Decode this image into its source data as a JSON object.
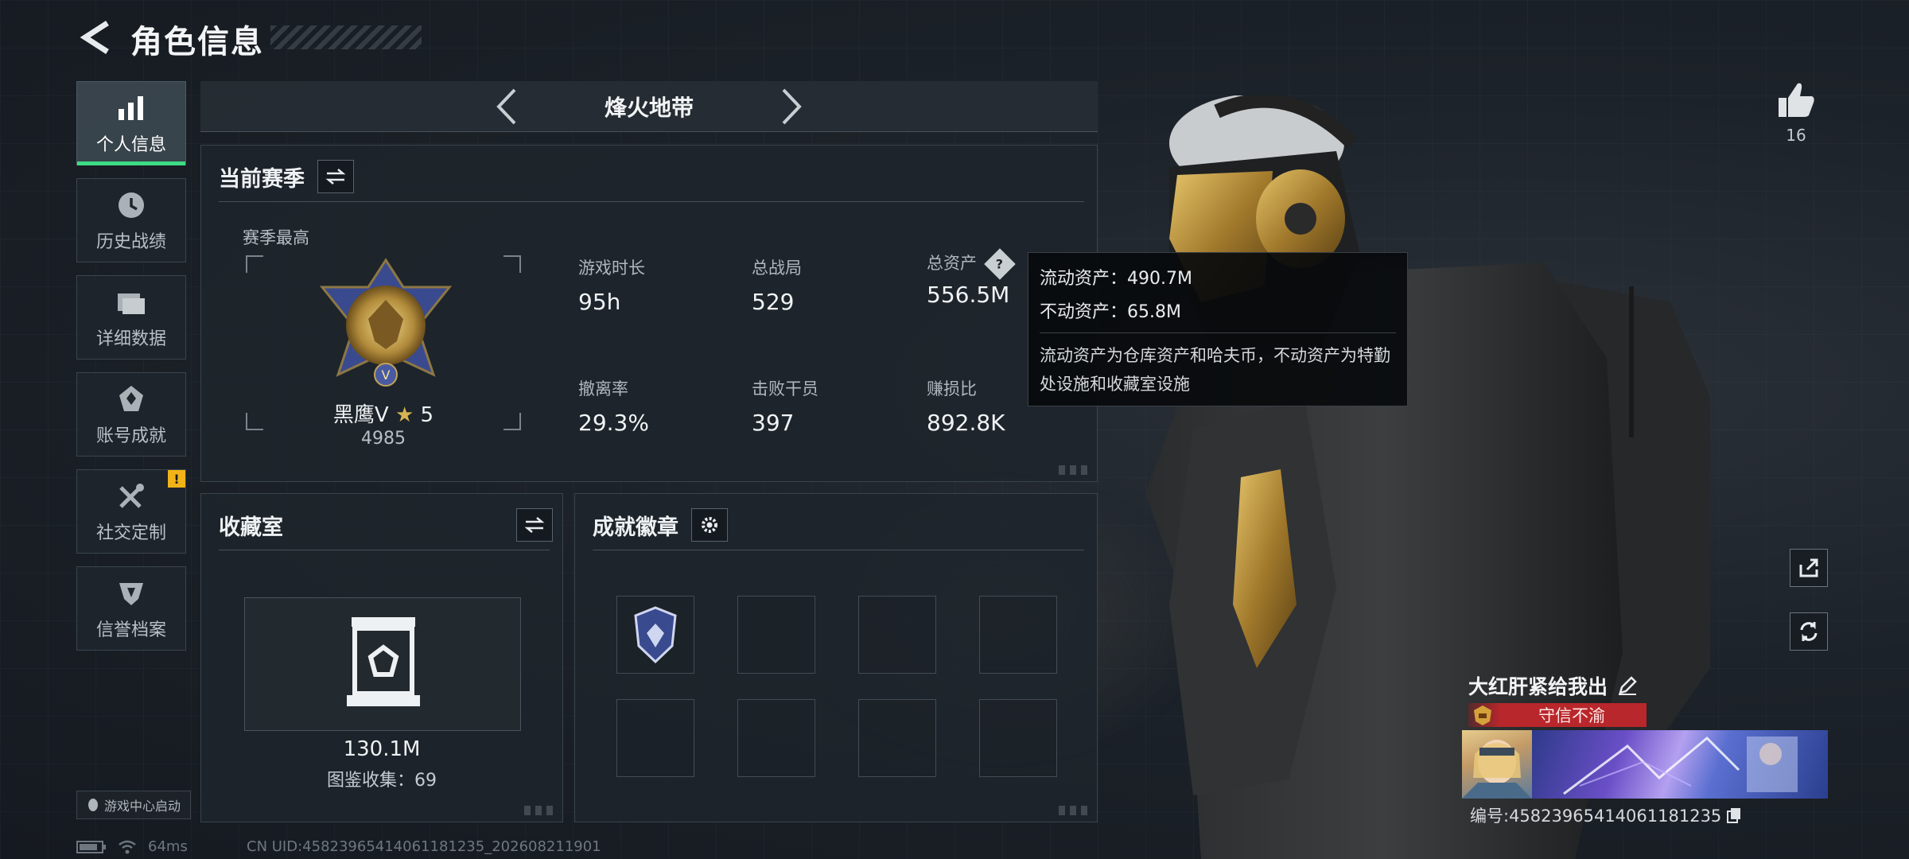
{
  "header": {
    "title": "角色信息"
  },
  "sidebar": {
    "items": [
      {
        "label": "个人信息",
        "icon": "bar-chart-icon",
        "active": true
      },
      {
        "label": "历史战绩",
        "icon": "clock-icon"
      },
      {
        "label": "详细数据",
        "icon": "folder-icon"
      },
      {
        "label": "账号成就",
        "icon": "medal-icon"
      },
      {
        "label": "社交定制",
        "icon": "tools-icon",
        "badge": "!"
      },
      {
        "label": "信誉档案",
        "icon": "shield-icon"
      }
    ],
    "game_center": "游戏中心启动"
  },
  "mode": {
    "title": "烽火地带"
  },
  "season": {
    "title": "当前赛季",
    "subtitle": "赛季最高",
    "rank_name": "黑鹰Ⅴ",
    "rank_stars": "5",
    "rank_points": "4985",
    "stats": [
      {
        "label": "游戏时长",
        "value": "95h"
      },
      {
        "label": "总战局",
        "value": "529"
      },
      {
        "label": "总资产",
        "value": "556.5M",
        "help": "?"
      },
      {
        "label": "撤离率",
        "value": "29.3%"
      },
      {
        "label": "击败干员",
        "value": "397"
      },
      {
        "label": "赚损比",
        "value": "892.8K"
      }
    ]
  },
  "tooltip": {
    "liquid": "流动资产：490.7M",
    "fixed": "不动资产：65.8M",
    "desc": "流动资产为仓库资产和哈夫币，不动资产为特勤处设施和收藏室设施"
  },
  "collection": {
    "title": "收藏室",
    "value": "130.1M",
    "count_label": "图鉴收集：69"
  },
  "badges": {
    "title": "成就徽章"
  },
  "social": {
    "likes": "16"
  },
  "player": {
    "name": "大红肝紧给我出",
    "credit": "守信不渝",
    "id_label": "编号:4582396541406 1181235",
    "id_text": "编号:458239654140611812​35"
  },
  "status": {
    "ping": "64ms",
    "uid": "CN UID:45823965414061181235_202608211901"
  },
  "colors": {
    "accent_green": "#3ddc84",
    "warn": "#f2b318",
    "credit_red": "#b8272b"
  }
}
